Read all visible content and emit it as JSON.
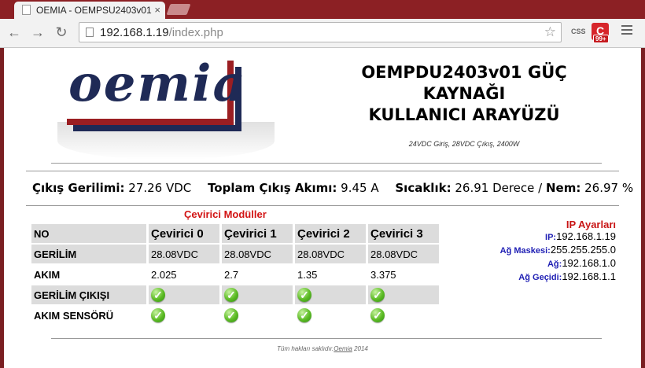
{
  "browser": {
    "tab_title": "OEMIA - OEMPSU2403v01",
    "tab_close": "×",
    "url_host": "192.168.1.19",
    "url_path": "/index.php",
    "star": "☆",
    "ext_css_label": "CSS",
    "ext_red_label": "C",
    "ext_badge": "99+",
    "back": "←",
    "forward": "→",
    "reload": "↻"
  },
  "logo": {
    "text": "oemia"
  },
  "header": {
    "title_line1": "OEMPDU2403v01 GÜÇ",
    "title_line2": "KAYNAĞI",
    "title_line3": "KULLANICI ARAYÜZÜ",
    "subtitle": "24VDC Giriş, 28VDC Çıkış, 2400W"
  },
  "stats": {
    "voltage_label": "Çıkış Gerilimi:",
    "voltage_value": "27.26 VDC",
    "current_label": "Toplam Çıkış Akımı:",
    "current_value": "9.45 A",
    "temp_label": "Sıcaklık:",
    "temp_value": "26.91 Derece /",
    "humidity_label": "Nem:",
    "humidity_value": "26.97 %"
  },
  "modules": {
    "title": "Çevirici Modüller",
    "header_no": "NO",
    "columns": [
      "Çevirici 0",
      "Çevirici 1",
      "Çevirici 2",
      "Çevirici 3"
    ],
    "row_voltage_label": "GERİLİM",
    "voltages": [
      "28.08VDC",
      "28.08VDC",
      "28.08VDC",
      "28.08VDC"
    ],
    "row_current_label": "AKIM",
    "currents": [
      "2.025",
      "2.7",
      "1.35",
      "3.375"
    ],
    "row_voltage_out_label": "GERİLİM ÇIKIŞI",
    "row_current_sensor_label": "AKIM SENSÖRÜ",
    "ok_icon": "✓",
    "ok_color": "#5cbb24"
  },
  "ip": {
    "title": "IP Ayarları",
    "ip_label": "IP:",
    "ip_value": "192.168.1.19",
    "mask_label": "Ağ Maskesi:",
    "mask_value": "255.255.255.0",
    "net_label": "Ağ:",
    "net_value": "192.168.1.0",
    "gw_label": "Ağ Geçidi:",
    "gw_value": "192.168.1.1"
  },
  "footer": {
    "text": "Tüm hakları saklıdır.",
    "link": "Oemia",
    "year": " 2014"
  },
  "colors": {
    "frame": "#7a1f22",
    "accent_red": "#d21414",
    "ip_key_blue": "#1f1fb4",
    "logo_navy": "#1f2a56"
  }
}
